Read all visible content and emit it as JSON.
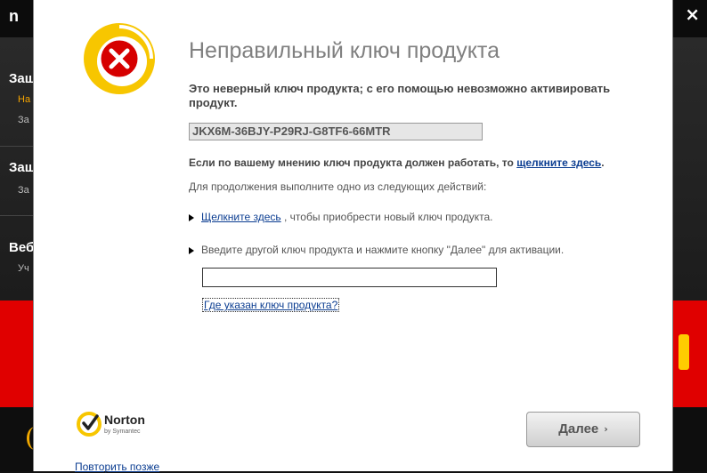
{
  "background": {
    "logo_fragment": "n",
    "close_glyph": "×",
    "sidebar": [
      {
        "heading": "Защ",
        "sub_a": "На",
        "sub_b": "За"
      },
      {
        "heading": "Защ",
        "sub_b": "За"
      },
      {
        "heading": "Веб",
        "sub_b": "Уч"
      }
    ]
  },
  "dialog": {
    "icon": "error-x-icon",
    "title": "Неправильный ключ продукта",
    "description": "Это неверный ключ продукта; с его помощью невозможно активировать продукт.",
    "product_key": "JKX6M-36BJY-P29RJ-G8TF6-66MTR",
    "hint_prefix": "Если по вашему мнению ключ продукта должен работать, то ",
    "hint_link": "щелкните здесь",
    "hint_suffix": ".",
    "instruction": "Для продолжения выполните одно из следующих действий:",
    "option1_link": "Щелкните здесь",
    "option1_text": " , чтобы приобрести новый ключ продукта.",
    "option2_text": "Введите другой ключ продукта и нажмите кнопку \"Далее\" для активации.",
    "key_input_value": "",
    "where_link": "Где указан ключ продукта?",
    "brand": "Norton",
    "brand_sub": "by Symantec",
    "next_button": "Далее",
    "next_chevron": "›",
    "later_link": "Повторить позже"
  },
  "colors": {
    "accent_yellow": "#f7c600",
    "error_red": "#d60000",
    "link": "#0b3d91"
  }
}
